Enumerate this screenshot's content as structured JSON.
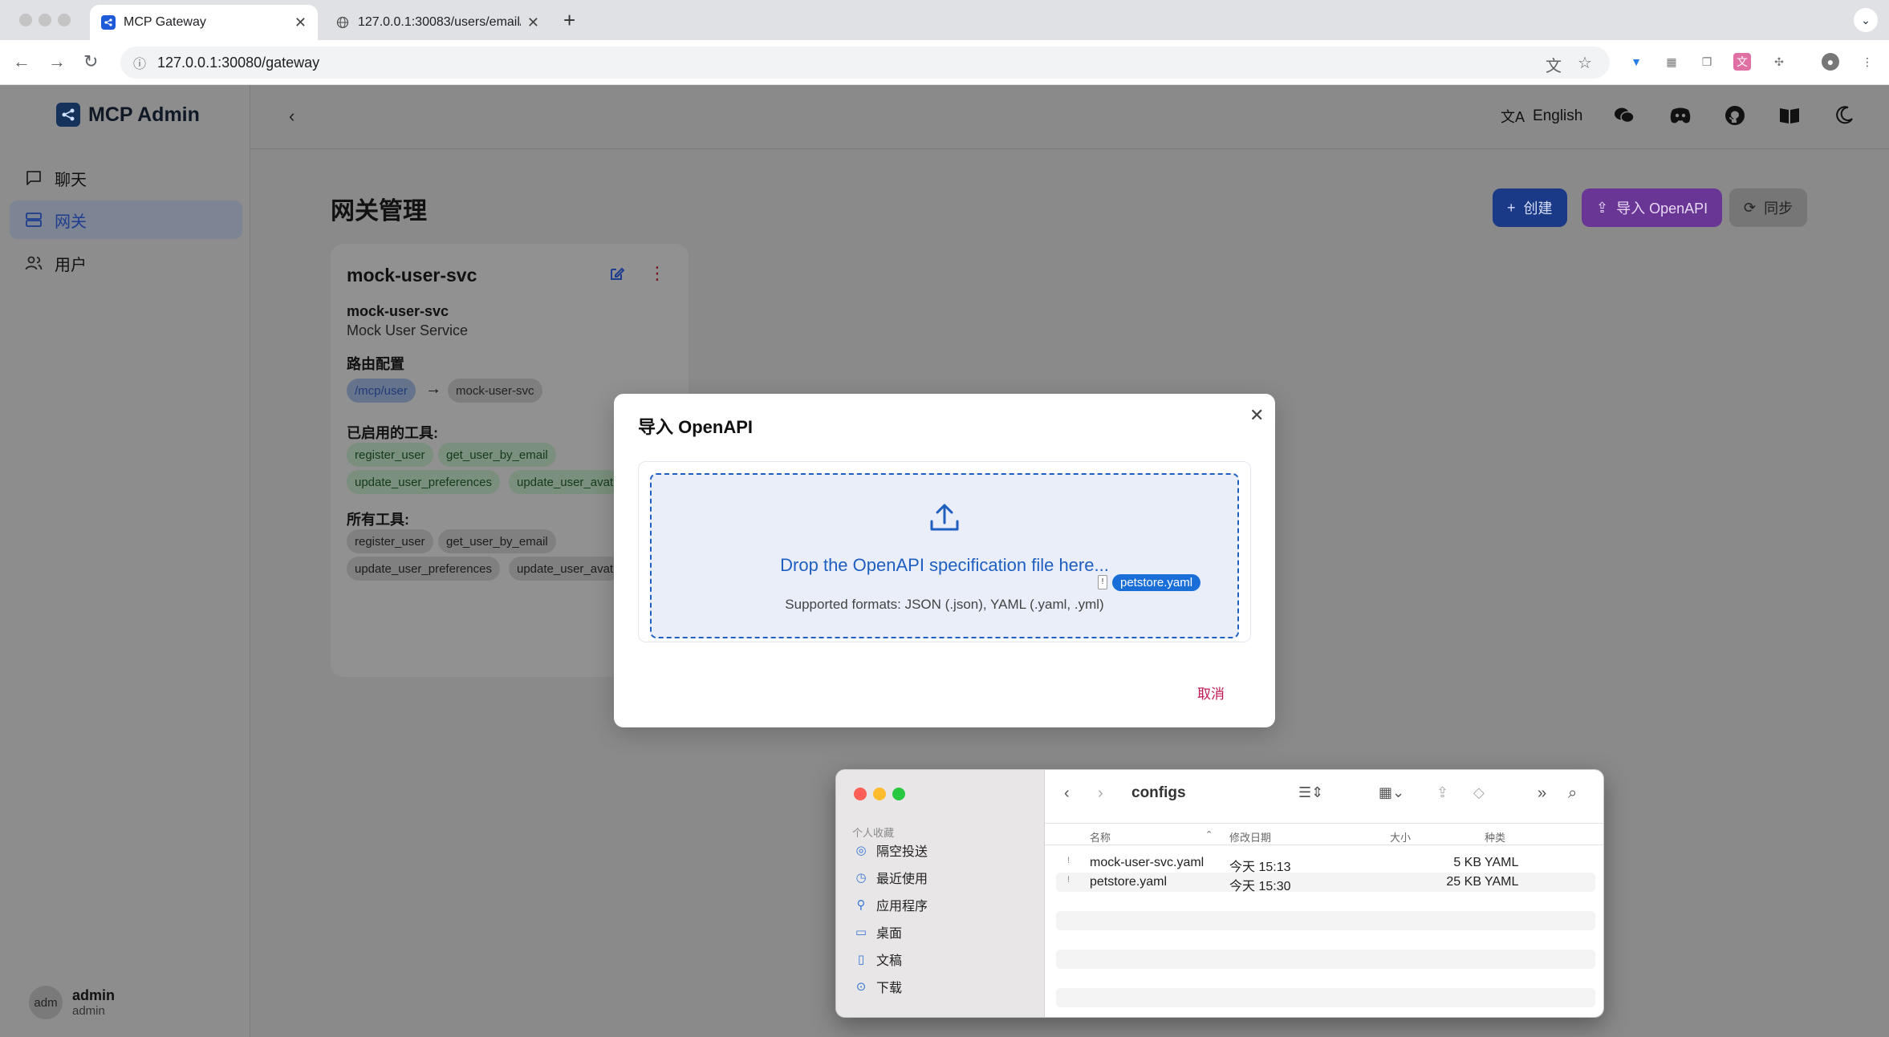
{
  "browser": {
    "tabs": [
      {
        "title": "MCP Gateway",
        "active": true
      },
      {
        "title": "127.0.0.1:30083/users/email/",
        "active": false
      }
    ],
    "url": "127.0.0.1:30080/gateway"
  },
  "app": {
    "brand": "MCP Admin",
    "nav": [
      {
        "label": "聊天",
        "icon": "chat-icon",
        "active": false
      },
      {
        "label": "网关",
        "icon": "server-icon",
        "active": true
      },
      {
        "label": "用户",
        "icon": "users-icon",
        "active": false
      }
    ],
    "user": {
      "avatar": "adm",
      "name": "admin",
      "role": "admin"
    },
    "topbar": {
      "language": "English"
    },
    "page_title": "网关管理",
    "actions": {
      "create": "创建",
      "import": "导入 OpenAPI",
      "sync": "同步"
    },
    "card": {
      "title": "mock-user-svc",
      "name": "mock-user-svc",
      "description": "Mock User Service",
      "routing_label": "路由配置",
      "route_path": "/mcp/user",
      "route_target": "mock-user-svc",
      "enabled_tools_label": "已启用的工具:",
      "enabled_tools": [
        "register_user",
        "get_user_by_email",
        "update_user_preferences",
        "update_user_avat"
      ],
      "all_tools_label": "所有工具:",
      "all_tools": [
        "register_user",
        "get_user_by_email",
        "update_user_preferences",
        "update_user_avat"
      ]
    }
  },
  "modal": {
    "title": "导入 OpenAPI",
    "drop_text": "Drop the OpenAPI specification file here...",
    "formats": "Supported formats: JSON (.json), YAML (.yaml, .yml)",
    "drag_file": "petstore.yaml",
    "cancel": "取消"
  },
  "finder": {
    "folder": "configs",
    "favorites_label": "个人收藏",
    "sidebar": [
      {
        "label": "隔空投送",
        "icon": "airdrop-icon"
      },
      {
        "label": "最近使用",
        "icon": "clock-icon"
      },
      {
        "label": "应用程序",
        "icon": "apps-icon"
      },
      {
        "label": "桌面",
        "icon": "desktop-icon"
      },
      {
        "label": "文稿",
        "icon": "document-icon"
      },
      {
        "label": "下载",
        "icon": "download-icon"
      }
    ],
    "columns": {
      "name": "名称",
      "date": "修改日期",
      "size": "大小",
      "kind": "种类"
    },
    "files": [
      {
        "name": "mock-user-svc.yaml",
        "date": "今天 15:13",
        "size": "5 KB",
        "kind": "YAML"
      },
      {
        "name": "petstore.yaml",
        "date": "今天 15:30",
        "size": "25 KB",
        "kind": "YAML"
      }
    ]
  },
  "colors": {
    "accent_blue": "#1f5fbf",
    "create_button": "#1a3a88",
    "import_button": "#6a3696",
    "cancel_text": "#c0184f"
  }
}
